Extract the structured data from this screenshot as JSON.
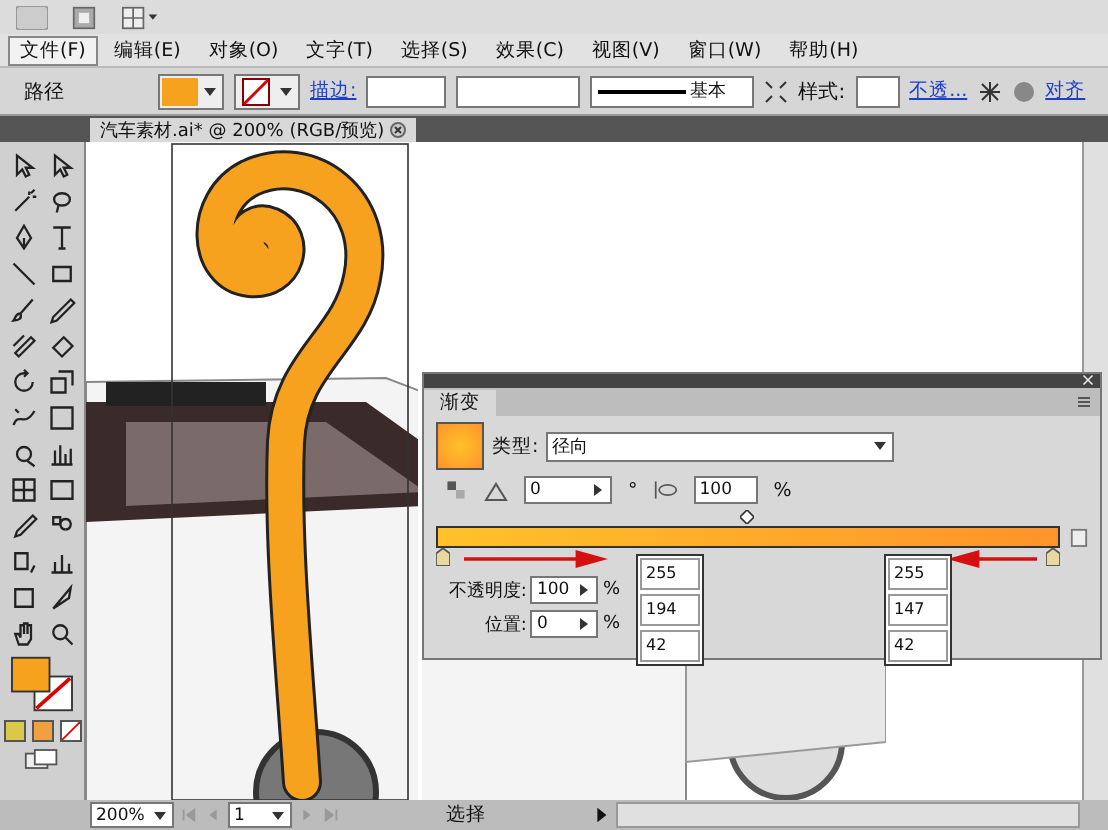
{
  "menu": [
    {
      "label": "文件(F)",
      "selected": true
    },
    {
      "label": "编辑(E)",
      "selected": false
    },
    {
      "label": "对象(O)",
      "selected": false
    },
    {
      "label": "文字(T)",
      "selected": false
    },
    {
      "label": "选择(S)",
      "selected": false
    },
    {
      "label": "效果(C)",
      "selected": false
    },
    {
      "label": "视图(V)",
      "selected": false
    },
    {
      "label": "窗口(W)",
      "selected": false
    },
    {
      "label": "帮助(H)",
      "selected": false
    }
  ],
  "control_bar": {
    "object_type": "路径",
    "stroke_link": "描边:",
    "stroke_profile": "基本",
    "style_label": "样式:",
    "opacity_link": "不透...",
    "align_link": "对齐"
  },
  "document_tab": {
    "title": "汽车素材.ai* @ 200% (RGB/预览)"
  },
  "gradient_panel": {
    "tab": "渐变",
    "midpoint": {
      "level": 0.5
    },
    "type_label": "类型:",
    "type_value": "径向",
    "angle": "0",
    "degree": "°",
    "aspect": "100",
    "aspect_unit": "%",
    "opacity_label": "不透明度:",
    "opacity": "100",
    "opacity_unit": "%",
    "location_label": "位置:",
    "location": "0",
    "location_unit": "%",
    "callouts": [
      {
        "values": [
          "255",
          "194",
          "42"
        ]
      },
      {
        "values": [
          "255",
          "147",
          "42"
        ]
      }
    ]
  },
  "status_bar": {
    "zoom": "200%",
    "page": "1",
    "tool": "选择"
  }
}
